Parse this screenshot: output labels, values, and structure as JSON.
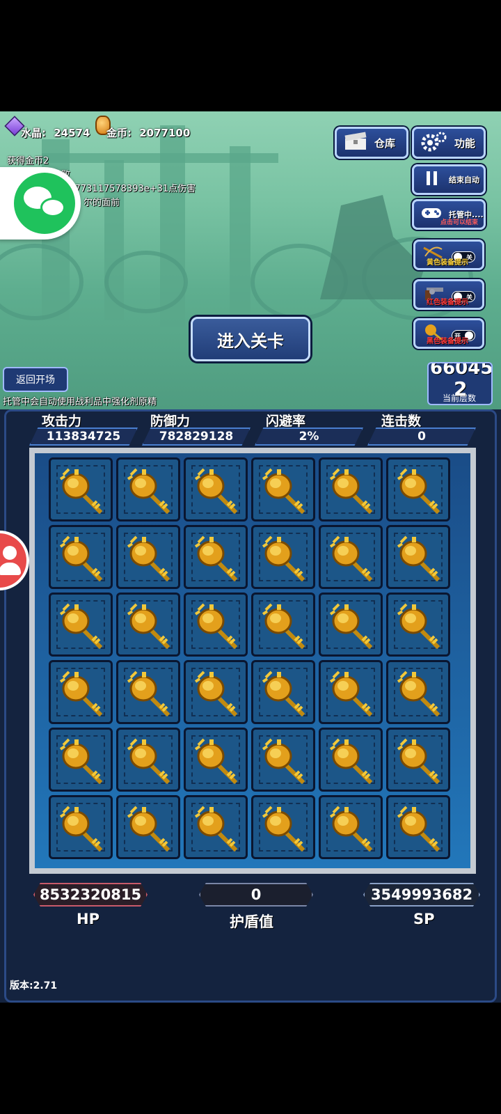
{
  "resources": {
    "crystal_label": "水晶:",
    "crystal_value": "24574",
    "gold_label": "金币:",
    "gold_value": "2077100"
  },
  "battle_log": [
    "获得金币2",
    "你你的攻击失败",
    "对你造成2.1210773117578393e+31点伤害",
    "尔的面前"
  ],
  "top_buttons": {
    "warehouse": "仓库",
    "functions": "功能",
    "end_auto": "结束自动",
    "managed": "托管中....",
    "managed_sub": "点击可以结束"
  },
  "equip_toggles": [
    {
      "label": "黄色装备提示",
      "state": "关",
      "color": "#ffd23a"
    },
    {
      "label": "红色装备提示",
      "state": "关",
      "color": "#ff3b3b"
    },
    {
      "label": "黑色装备提示",
      "state": "开",
      "color": "#ff3b3b"
    }
  ],
  "enter_stage": "进入关卡",
  "back_button": "返回开场",
  "auto_note": "托管中会自动使用战利品中强化剂原精",
  "floor": {
    "big_number": "66045",
    "current": "2",
    "caption": "当前层数"
  },
  "stats": {
    "attack_label": "攻击力",
    "attack_value": "113834725",
    "defense_label": "防御力",
    "defense_value": "782829128",
    "dodge_label": "闪避率",
    "dodge_value": "2%",
    "combo_label": "连击数",
    "combo_value": "0"
  },
  "inventory": {
    "rows": 6,
    "cols": 6,
    "item_icon": "golden-scepter-icon"
  },
  "bottom": {
    "hp_value": "8532320815",
    "shield_value": "0",
    "sp_value": "3549993682",
    "hp_label": "HP",
    "shield_label": "护盾值",
    "sp_label": "SP"
  },
  "version": "版本:2.71"
}
